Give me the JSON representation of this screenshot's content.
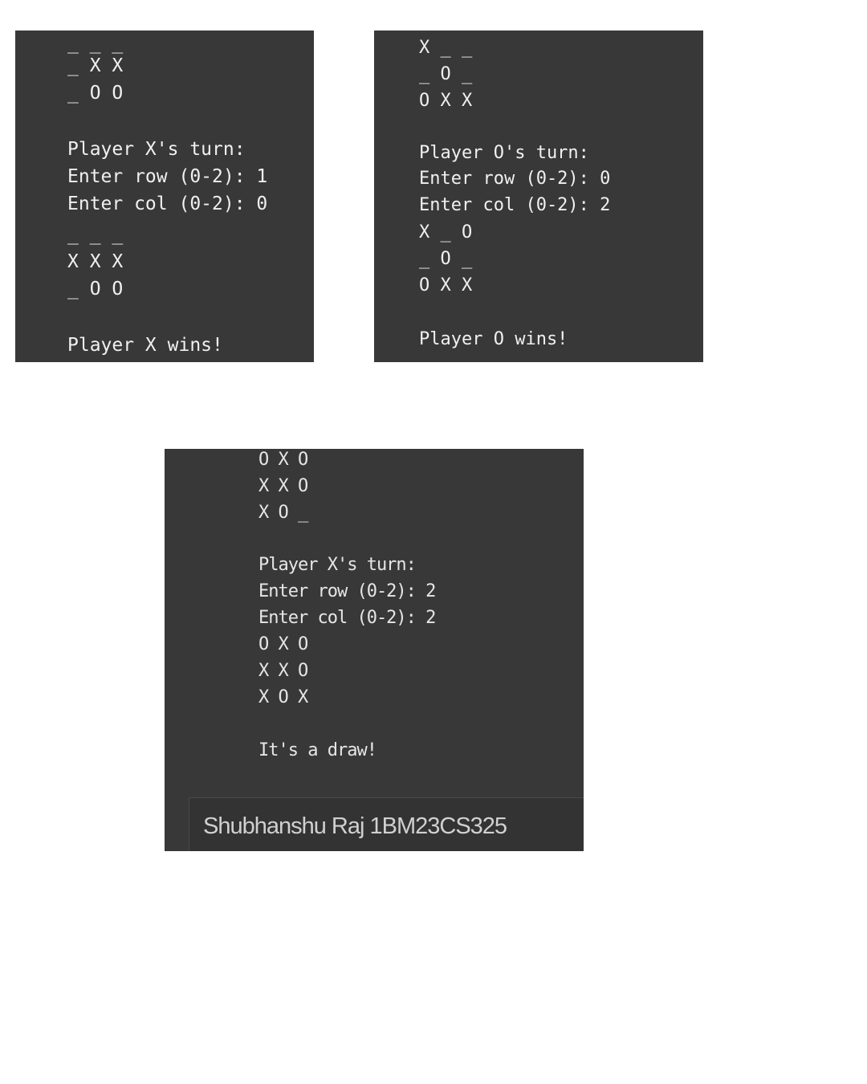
{
  "panels": [
    {
      "id": "x-wins",
      "lines": [
        "_ _ _",
        "_ X X",
        "_ O O",
        "",
        "Player X's turn:",
        "Enter row (0-2): 1",
        "Enter col (0-2): 0",
        "_ _ _",
        "X X X",
        "_ O O",
        "",
        "Player X wins!"
      ]
    },
    {
      "id": "o-wins",
      "lines": [
        "X _ _",
        "_ O _",
        "O X X",
        "",
        "Player O's turn:",
        "Enter row (0-2): 0",
        "Enter col (0-2): 2",
        "X _ O",
        "_ O _",
        "O X X",
        "",
        "Player O wins!"
      ]
    },
    {
      "id": "draw",
      "lines": [
        "O X O",
        "X X O",
        "X O _",
        "",
        "Player X's turn:",
        "Enter row (0-2): 2",
        "Enter col (0-2): 2",
        "O X O",
        "X X O",
        "X O X",
        "",
        "It's a draw!"
      ],
      "caption": "Shubhanshu Raj 1BM23CS325"
    }
  ]
}
